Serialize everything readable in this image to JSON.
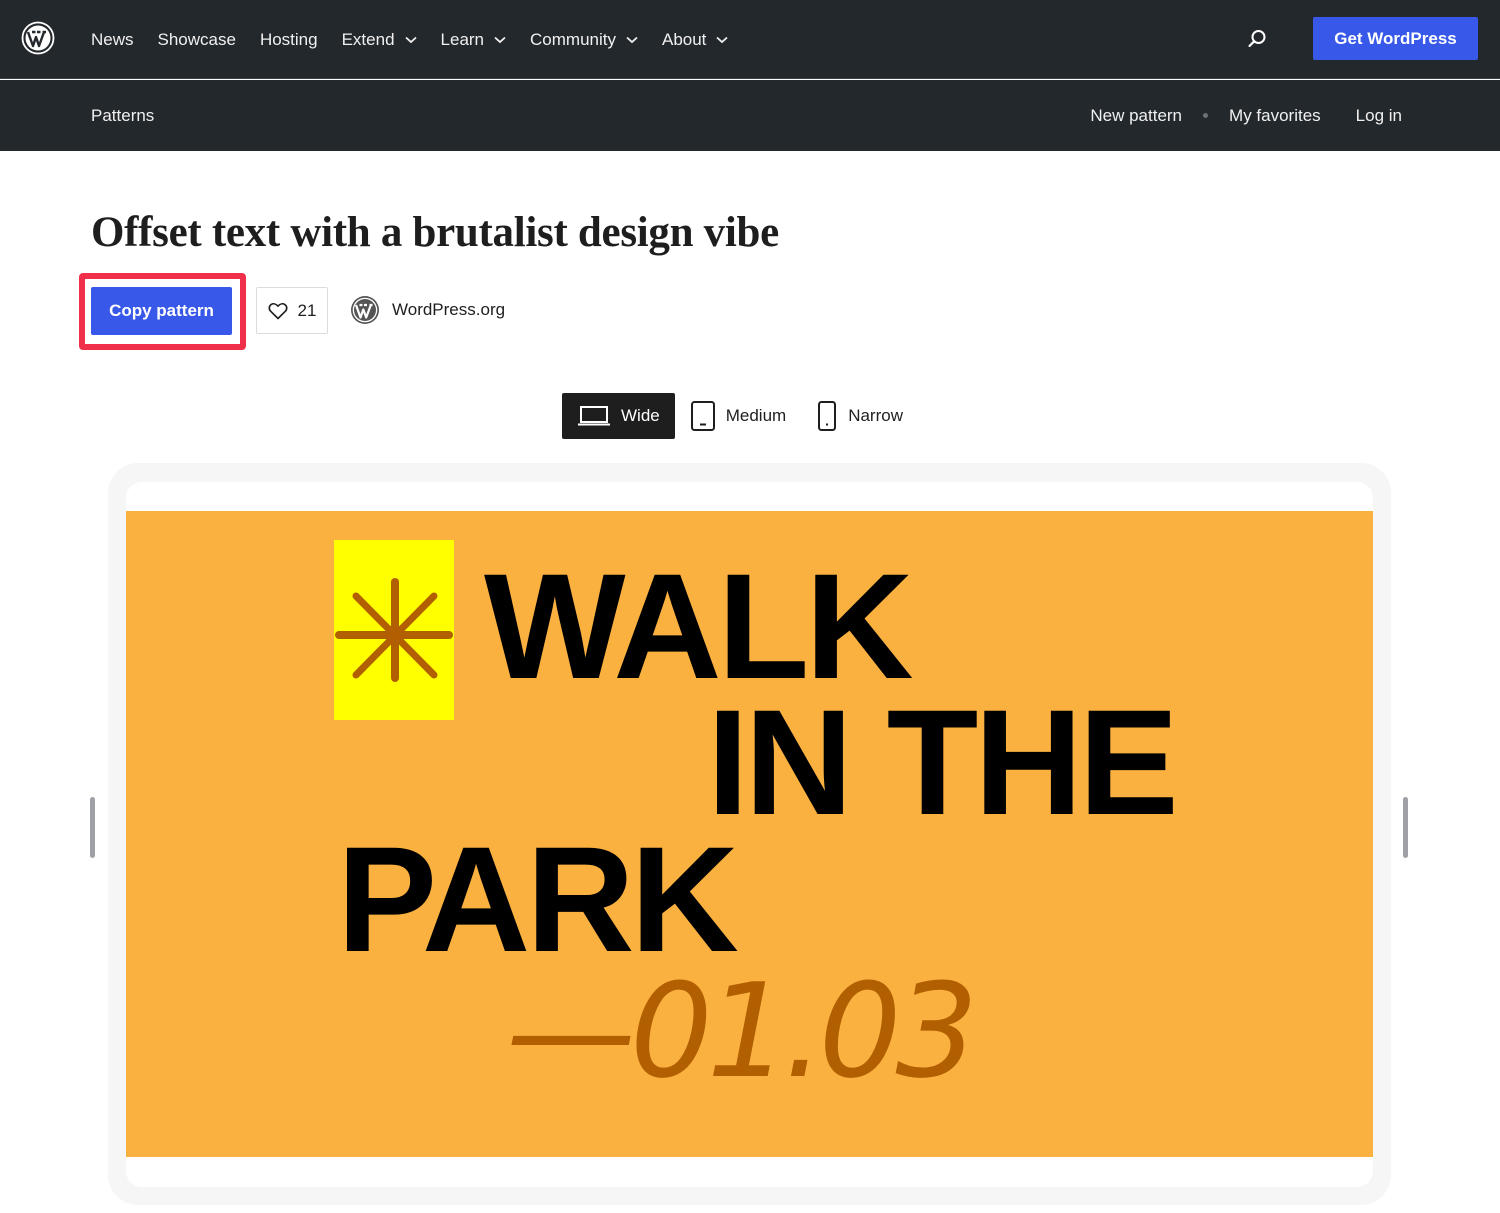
{
  "topbar": {
    "nav": [
      {
        "label": "News",
        "has_dropdown": false
      },
      {
        "label": "Showcase",
        "has_dropdown": false
      },
      {
        "label": "Hosting",
        "has_dropdown": false
      },
      {
        "label": "Extend",
        "has_dropdown": true
      },
      {
        "label": "Learn",
        "has_dropdown": true
      },
      {
        "label": "Community",
        "has_dropdown": true
      },
      {
        "label": "About",
        "has_dropdown": true
      }
    ],
    "search_icon": "search-icon",
    "cta_label": "Get WordPress",
    "accent_color": "#3858e9",
    "background_color": "#23282d"
  },
  "subbar": {
    "title": "Patterns",
    "links": {
      "new_pattern": "New pattern",
      "my_favorites": "My favorites",
      "log_in": "Log in"
    }
  },
  "pattern": {
    "title": "Offset text with a brutalist design vibe",
    "copy_label": "Copy pattern",
    "favorites_count": "21",
    "author": "WordPress.org",
    "highlight_color": "#f0304a"
  },
  "viewport": {
    "options": [
      {
        "label": "Wide",
        "icon": "laptop-icon",
        "active": true
      },
      {
        "label": "Medium",
        "icon": "tablet-icon",
        "active": false
      },
      {
        "label": "Narrow",
        "icon": "phone-icon",
        "active": false
      }
    ]
  },
  "preview": {
    "line1": "WALK",
    "line2": "IN THE",
    "line3": "PARK",
    "line4": "—01.03",
    "background_color": "#fbb140",
    "star_box_color": "#ffff00",
    "star_color": "#b15f00",
    "text_color": "#000000",
    "date_color": "#b15f00"
  }
}
